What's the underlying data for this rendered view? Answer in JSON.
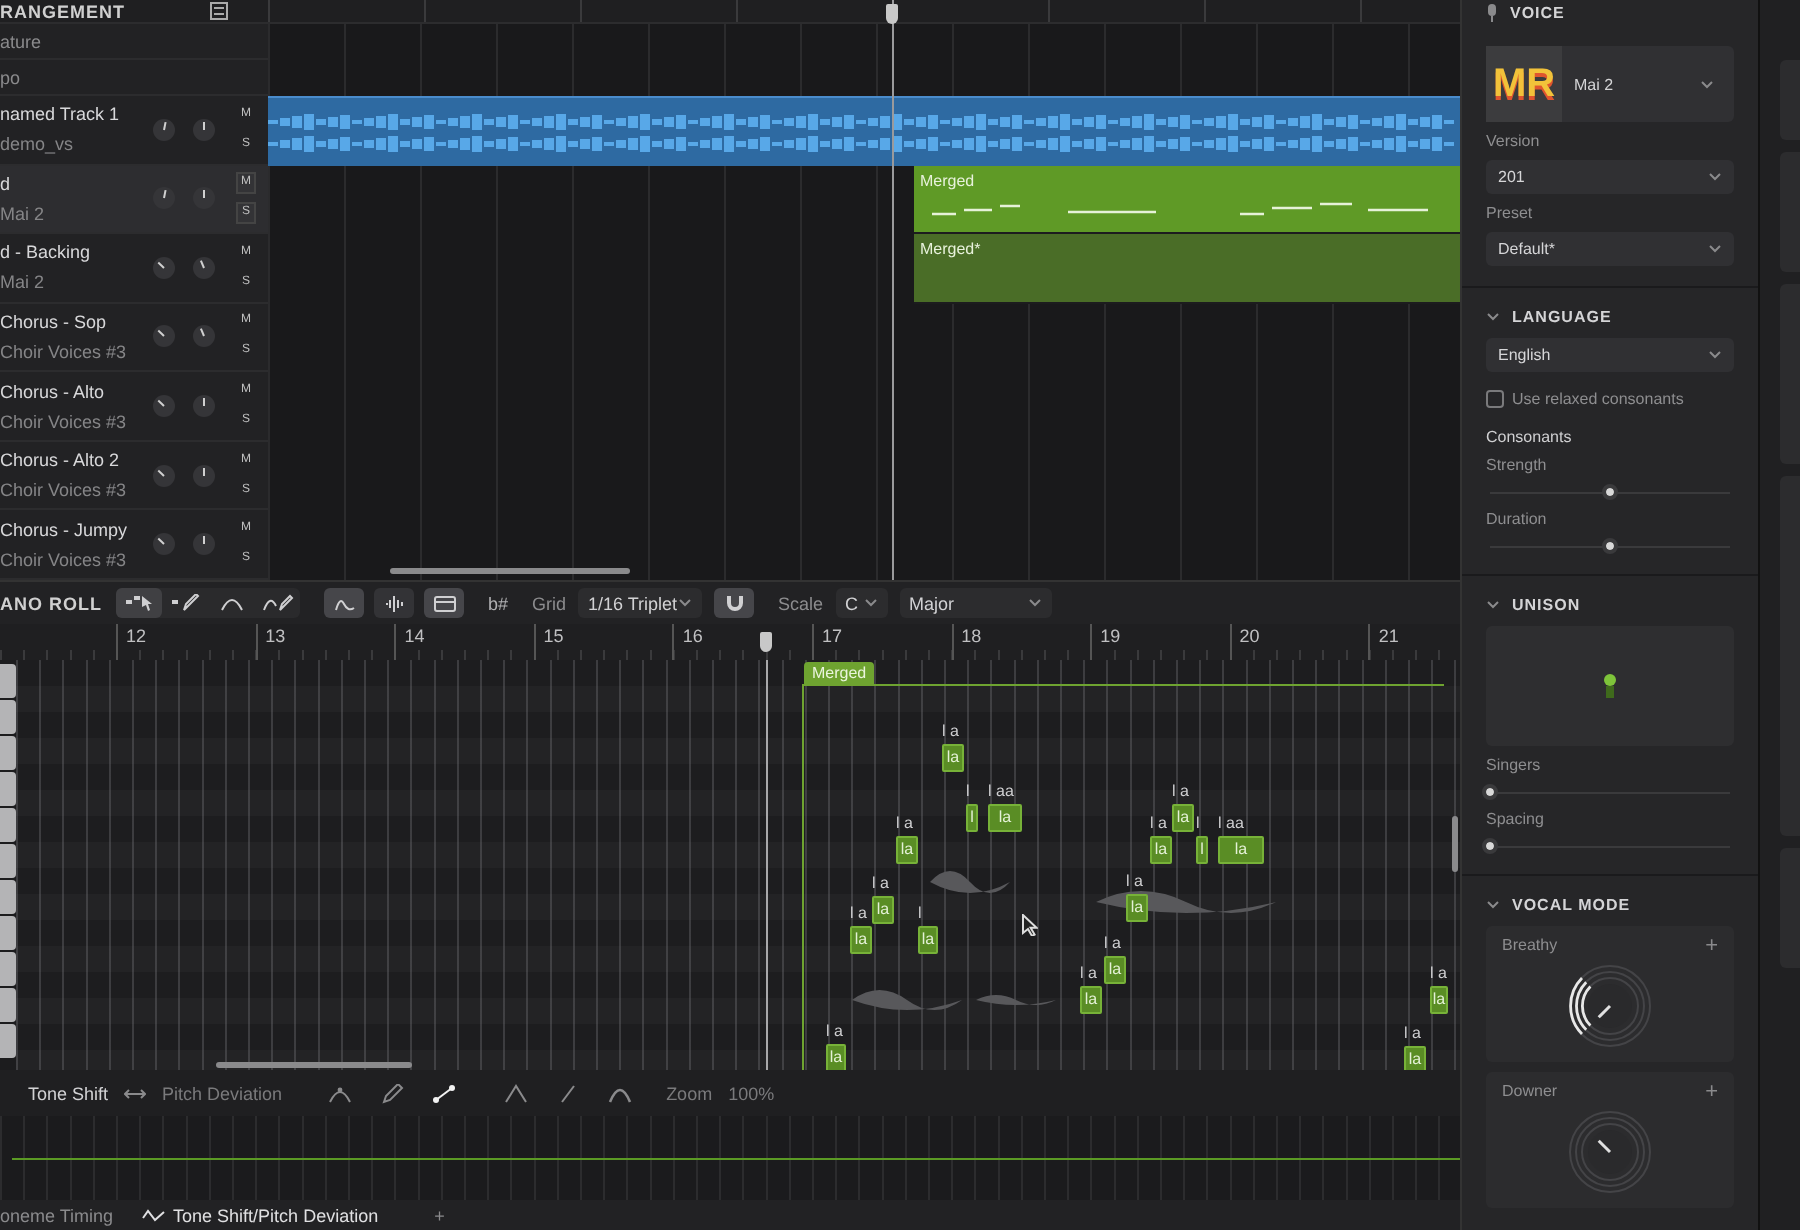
{
  "arrangement": {
    "title": "RANGEMENT",
    "rows": [
      {
        "label": "ature"
      },
      {
        "label": "po"
      }
    ],
    "tracks": [
      {
        "name": "named Track 1",
        "source": "demo_vs",
        "selected": false,
        "mute": "M",
        "solo": "S",
        "clip": {
          "kind": "audio",
          "selected": true
        }
      },
      {
        "name": "d",
        "source": "Mai 2",
        "selected": true,
        "mute": "M",
        "solo": "S",
        "clip": {
          "kind": "notes",
          "label": "Merged",
          "selected": true
        }
      },
      {
        "name": "d - Backing",
        "source": "Mai 2",
        "selected": false,
        "mute": "M",
        "solo": "S",
        "clip": {
          "kind": "notes",
          "label": "Merged*",
          "selected": false
        }
      },
      {
        "name": "Chorus - Sop",
        "source": "Choir Voices #3",
        "selected": false,
        "mute": "M",
        "solo": "S"
      },
      {
        "name": "Chorus - Alto",
        "source": "Choir Voices #3",
        "selected": false,
        "mute": "M",
        "solo": "S"
      },
      {
        "name": "Chorus - Alto 2",
        "source": "Choir Voices #3",
        "selected": false,
        "mute": "M",
        "solo": "S"
      },
      {
        "name": "Chorus - Jumpy",
        "source": "Choir Voices #3",
        "selected": false,
        "mute": "M",
        "solo": "S"
      }
    ]
  },
  "piano_roll": {
    "title": "ANO ROLL",
    "tools": [
      {
        "kind": "select",
        "selected": true
      },
      {
        "kind": "pencil",
        "selected": false
      },
      {
        "kind": "curve",
        "selected": false
      },
      {
        "kind": "curve-pencil",
        "selected": false
      }
    ],
    "views": [
      {
        "kind": "pitch",
        "selected": true
      },
      {
        "kind": "wave",
        "selected": false
      },
      {
        "kind": "clip",
        "selected": true
      }
    ],
    "accidentals": "b#",
    "grid_label": "Grid",
    "grid": "1/16 Triplet",
    "snap": true,
    "scale_label": "Scale",
    "key": "C",
    "mode": "Major",
    "ruler": [
      "12",
      "13",
      "14",
      "15",
      "16",
      "17",
      "18",
      "19",
      "20",
      "21"
    ],
    "region": "Merged",
    "notes": [
      {
        "lyric": "la",
        "phonemes": "l a"
      },
      {
        "lyric": "la",
        "phonemes": "l a"
      },
      {
        "lyric": "la",
        "phonemes": "l a"
      },
      {
        "lyric": "la",
        "phonemes": "l a"
      },
      {
        "lyric": "la",
        "phonemes": "l"
      },
      {
        "lyric": "la",
        "phonemes": "l a"
      },
      {
        "lyric": "l",
        "phonemes": "l"
      },
      {
        "lyric": "la",
        "phonemes": "l aa"
      },
      {
        "lyric": "la",
        "phonemes": "l a"
      },
      {
        "lyric": "la",
        "phonemes": "l a"
      },
      {
        "lyric": "la",
        "phonemes": "l a"
      },
      {
        "lyric": "la",
        "phonemes": "l a"
      },
      {
        "lyric": "la",
        "phonemes": "l a"
      },
      {
        "lyric": "l",
        "phonemes": "l"
      },
      {
        "lyric": "la",
        "phonemes": "l aa"
      },
      {
        "lyric": "la",
        "phonemes": "l a"
      },
      {
        "lyric": "la",
        "phonemes": "l a"
      }
    ]
  },
  "automation": {
    "parameter": "Tone Shift",
    "compare": "Pitch Deviation",
    "tools": [
      {
        "kind": "arc-point",
        "selected": false
      },
      {
        "kind": "pencil",
        "selected": false
      },
      {
        "kind": "line",
        "selected": true
      },
      {
        "kind": "peak",
        "selected": false
      },
      {
        "kind": "slash",
        "selected": false
      },
      {
        "kind": "arc",
        "selected": false
      }
    ],
    "zoom_label": "Zoom",
    "zoom": "100%"
  },
  "bottom_tabs": [
    {
      "label": "oneme Timing",
      "selected": false
    },
    {
      "label": "Tone Shift/Pitch Deviation",
      "selected": true
    }
  ],
  "add_tab": "+",
  "voice_panel": {
    "title": "VOICE",
    "logo": "MR",
    "voice": "Mai 2",
    "version_label": "Version",
    "version": "201",
    "preset_label": "Preset",
    "preset": "Default*",
    "language": {
      "title": "LANGUAGE",
      "expanded": true,
      "value": "English",
      "relaxed": {
        "label": "Use relaxed consonants",
        "checked": false
      },
      "consonants": "Consonants",
      "sliders": [
        {
          "label": "Strength",
          "level": 0.5
        },
        {
          "label": "Duration",
          "level": 0.5
        }
      ]
    },
    "unison": {
      "title": "UNISON",
      "expanded": true,
      "sliders": [
        {
          "label": "Singers",
          "level": 0.0
        },
        {
          "label": "Spacing",
          "level": 0.0
        }
      ]
    },
    "vocal_mode": {
      "title": "VOCAL MODE",
      "expanded": true,
      "modes": [
        {
          "label": "Breathy",
          "add": "+",
          "active": true
        },
        {
          "label": "Downer",
          "add": "+",
          "active": false
        }
      ]
    }
  }
}
